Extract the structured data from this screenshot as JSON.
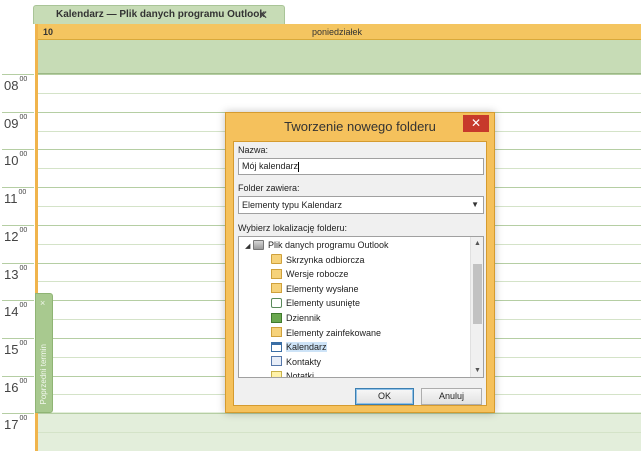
{
  "tab": {
    "title": "Kalendarz — Plik danych programu Outlook",
    "close": "✕"
  },
  "day_header": {
    "day_number": "10",
    "day_name": "poniedziałek"
  },
  "hours": [
    "08",
    "09",
    "10",
    "11",
    "12",
    "13",
    "14",
    "15",
    "16",
    "17"
  ],
  "hour_minutes": "00",
  "prev_appointment": {
    "label": "Poprzedni termin",
    "close": "×"
  },
  "colors": {
    "accent": "#f0b44c",
    "calendar_green": "#c7dcb6",
    "dialog_frame": "#f5c15c",
    "close_red": "#c7392b"
  },
  "dialog": {
    "title": "Tworzenie nowego folderu",
    "close": "✕",
    "name_label": "Nazwa:",
    "name_value": "Mój kalendarz",
    "contains_label": "Folder zawiera:",
    "contains_value": "Elementy typu Kalendarz",
    "location_label": "Wybierz lokalizację folderu:",
    "tree": [
      {
        "label": "Plik danych programu Outlook",
        "icon": "data-file-icon",
        "level": 0,
        "expander": "◢"
      },
      {
        "label": "Skrzynka odbiorcza",
        "icon": "inbox-icon",
        "level": 1
      },
      {
        "label": "Wersje robocze",
        "icon": "drafts-icon",
        "level": 1
      },
      {
        "label": "Elementy wysłane",
        "icon": "sent-items-icon",
        "level": 1
      },
      {
        "label": "Elementy usunięte",
        "icon": "deleted-items-icon",
        "level": 1
      },
      {
        "label": "Dziennik",
        "icon": "journal-icon",
        "level": 1
      },
      {
        "label": "Elementy zainfekowane",
        "icon": "infected-items-icon",
        "level": 1
      },
      {
        "label": "Kalendarz",
        "icon": "calendar-icon",
        "level": 1,
        "selected": true
      },
      {
        "label": "Kontakty",
        "icon": "contacts-icon",
        "level": 1
      },
      {
        "label": "Notatki",
        "icon": "notes-icon",
        "level": 1
      }
    ],
    "ok_label": "OK",
    "cancel_label": "Anuluj"
  }
}
